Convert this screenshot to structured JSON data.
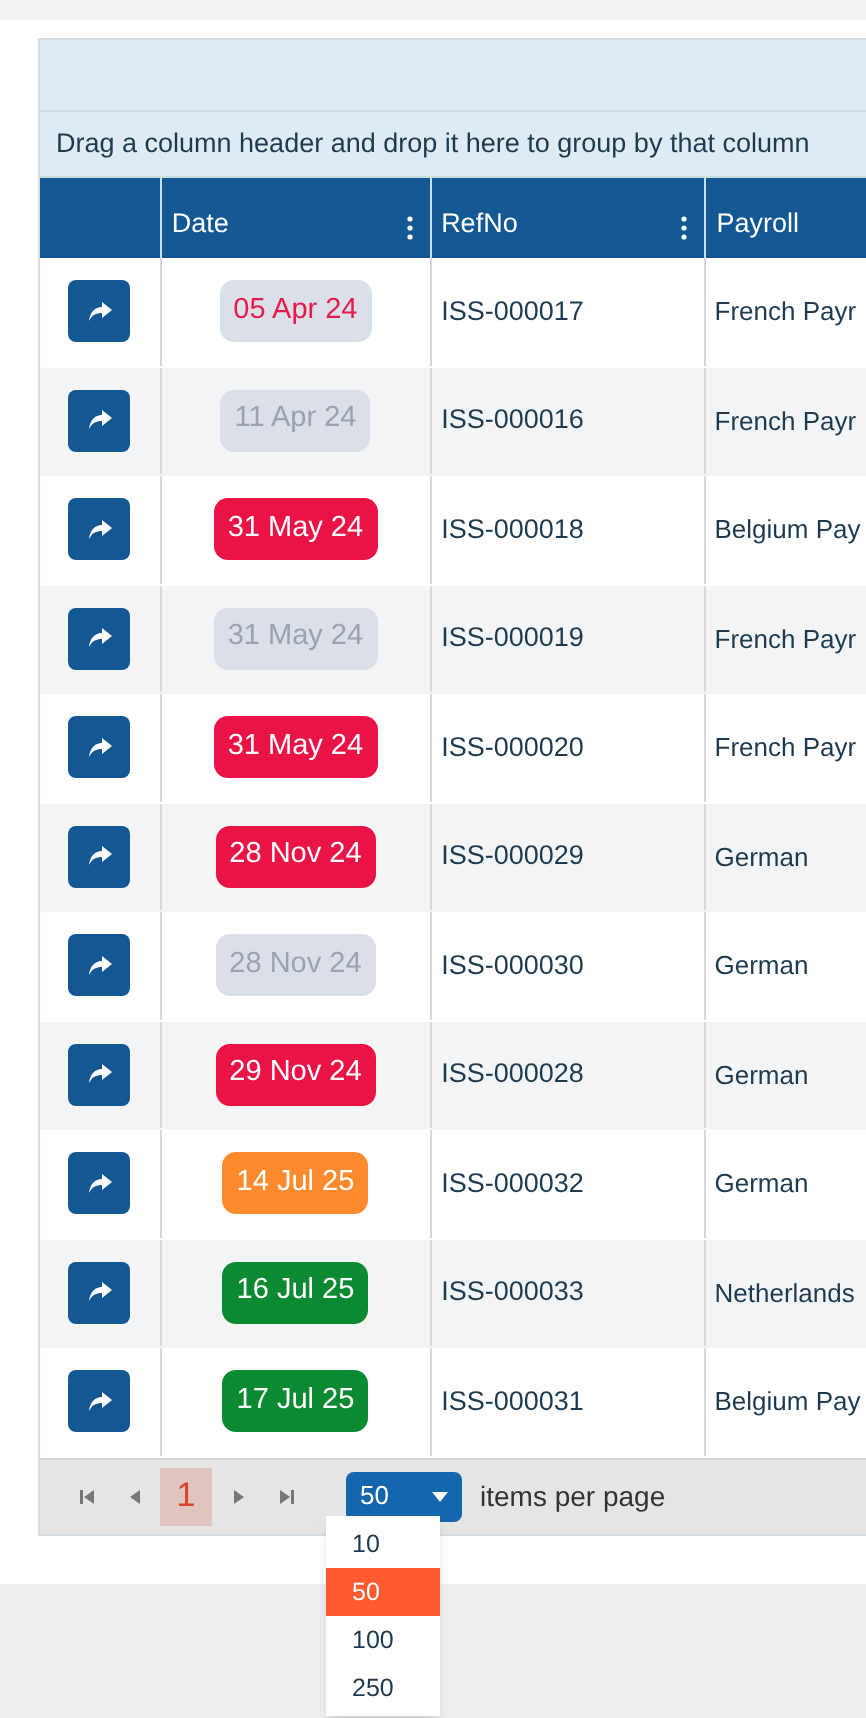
{
  "group_panel": {
    "hint": "Drag a column header and drop it here to group by that column"
  },
  "columns": [
    {
      "label": "Date",
      "menu": true
    },
    {
      "label": "RefNo",
      "menu": true
    },
    {
      "label": "Payroll"
    }
  ],
  "rows": [
    {
      "date": "05 Apr 24",
      "color": "#e8194b",
      "filled": false,
      "ref": "ISS-000017",
      "payroll": "French Payr"
    },
    {
      "date": "11 Apr 24",
      "color": "#9aa3af",
      "filled": false,
      "ref": "ISS-000016",
      "payroll": "French Payr"
    },
    {
      "date": "31 May 24",
      "color": "#ea1345",
      "filled": true,
      "ref": "ISS-000018",
      "payroll": "Belgium Pay"
    },
    {
      "date": "31 May 24",
      "color": "#9aa3af",
      "filled": false,
      "ref": "ISS-000019",
      "payroll": "French Payr"
    },
    {
      "date": "31 May 24",
      "color": "#ea1345",
      "filled": true,
      "ref": "ISS-000020",
      "payroll": "French Payr"
    },
    {
      "date": "28 Nov 24",
      "color": "#ea1345",
      "filled": true,
      "ref": "ISS-000029",
      "payroll": "German"
    },
    {
      "date": "28 Nov 24",
      "color": "#9aa3af",
      "filled": false,
      "ref": "ISS-000030",
      "payroll": "German"
    },
    {
      "date": "29 Nov 24",
      "color": "#ea1345",
      "filled": true,
      "ref": "ISS-000028",
      "payroll": "German"
    },
    {
      "date": "14 Jul 25",
      "color": "#fd8a2c",
      "filled": true,
      "ref": "ISS-000032",
      "payroll": "German"
    },
    {
      "date": "16 Jul 25",
      "color": "#0b8a31",
      "filled": true,
      "ref": "ISS-000033",
      "payroll": "Netherlands"
    },
    {
      "date": "17 Jul 25",
      "color": "#0b8a31",
      "filled": true,
      "ref": "ISS-000031",
      "payroll": "Belgium Pay"
    }
  ],
  "pager": {
    "pages": [
      {
        "label": "1",
        "selected": true
      }
    ],
    "page_size": "50",
    "page_size_label": "items per page",
    "page_size_options": [
      {
        "label": "10",
        "selected": false
      },
      {
        "label": "50",
        "selected": true
      },
      {
        "label": "100",
        "selected": false
      },
      {
        "label": "250",
        "selected": false
      }
    ]
  }
}
